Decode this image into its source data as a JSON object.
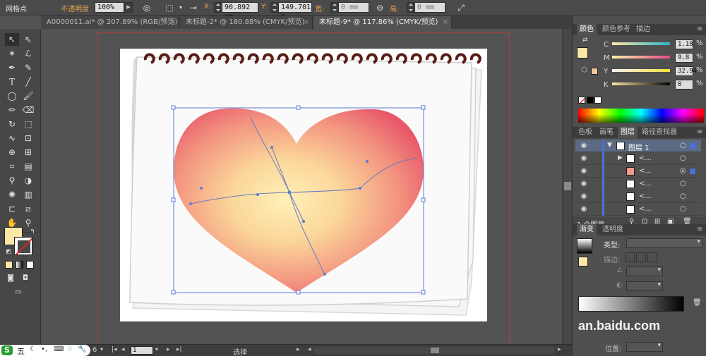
{
  "control": {
    "mode": "网格点",
    "opacity_label": "不透明度",
    "opacity_value": "100%",
    "x_label": "X:",
    "x_value": "90.892 mm",
    "y_label": "Y:",
    "y_value": "149.701 m",
    "w_label": "宽:",
    "w_value": "0 mm",
    "h_label": "高:",
    "h_value": "0 mm"
  },
  "tabs": [
    {
      "label": "A0000011.ai* @ 207.89% (RGB/预览)",
      "close": "×"
    },
    {
      "label": "未标题-2* @ 180.88% (CMYK/预览)",
      "close": "×"
    },
    {
      "label": "未标题-9* @ 117.86% (CMYK/预览)",
      "close": "×"
    }
  ],
  "status": {
    "zoom": "6",
    "page": "1",
    "tool": "选择"
  },
  "ime": {
    "logo": "S",
    "mode": "五"
  },
  "color_panel": {
    "tabs": [
      "颜色",
      "颜色参考",
      "描边"
    ],
    "channels": [
      {
        "name": "C",
        "value": "1.18",
        "unit": "%"
      },
      {
        "name": "M",
        "value": "9.8",
        "unit": "%"
      },
      {
        "name": "Y",
        "value": "32.94",
        "unit": "%"
      },
      {
        "name": "K",
        "value": "0",
        "unit": "%"
      }
    ],
    "fill_color": "#fde7a6"
  },
  "layers_panel": {
    "tabs": [
      "色板",
      "画笔",
      "图层",
      "路径查找器"
    ],
    "layers": [
      {
        "name": "图层 1"
      },
      {
        "name": "<..."
      },
      {
        "name": "<..."
      },
      {
        "name": "<..."
      },
      {
        "name": "<..."
      },
      {
        "name": "<..."
      }
    ],
    "footer": "1 个图层"
  },
  "gradient_panel": {
    "tabs": [
      "渐变",
      "透明度"
    ],
    "type_label": "类型:",
    "stroke_label": "描边:",
    "position_label": "位置:"
  },
  "watermark": {
    "text": "an.baidu.com"
  },
  "colors": {
    "accent": "#e8a44a",
    "selection": "#5b7bd4"
  }
}
